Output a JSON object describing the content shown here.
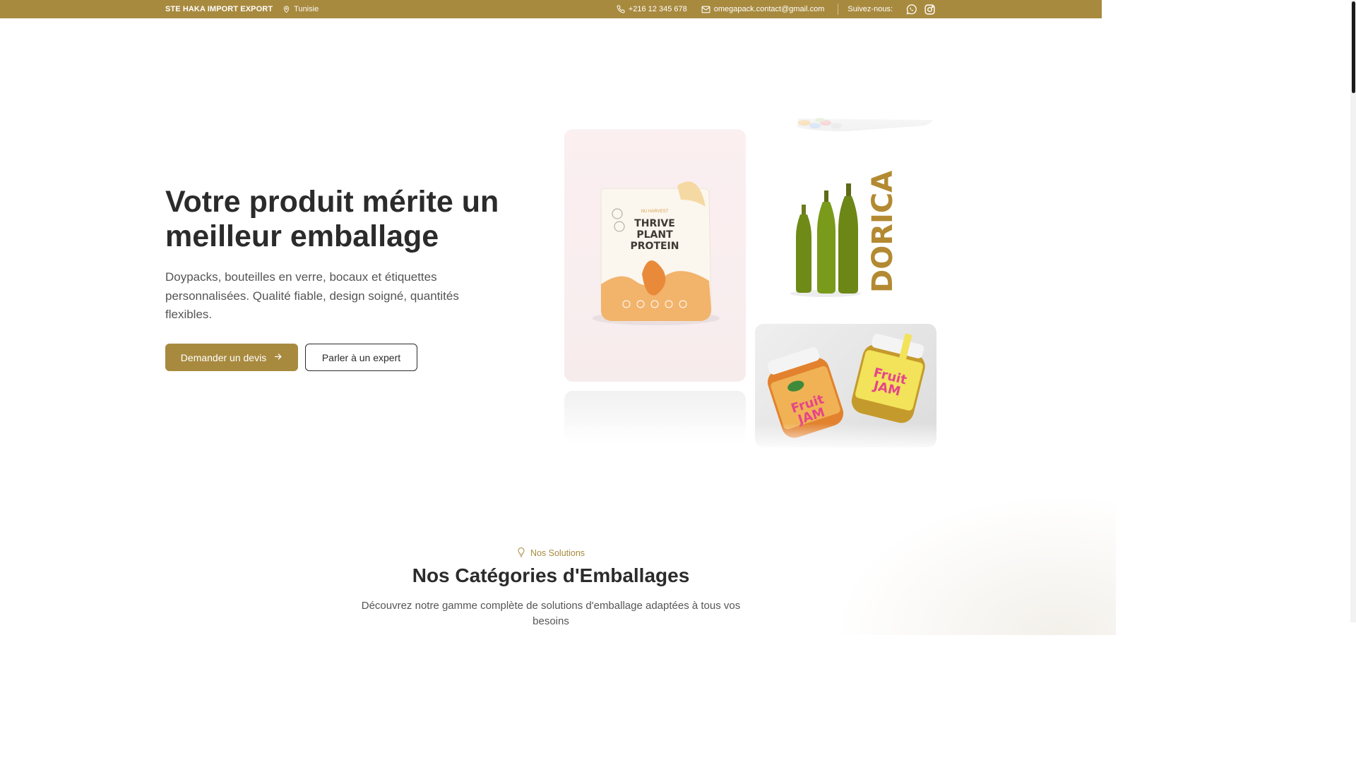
{
  "topbar": {
    "company": "STE HAKA IMPORT EXPORT",
    "location": "Tunisie",
    "phone": "+216 12 345 678",
    "email": "omegapack.contact@gmail.com",
    "follow_label": "Suivez-nous:",
    "social": [
      "whatsapp-icon",
      "instagram-icon"
    ],
    "background_color": "#a88a3f"
  },
  "hero": {
    "title": "Votre produit mérite un meilleur emballage",
    "subtitle": "Doypacks, bouteilles en verre, bocaux et étiquettes personnalisées. Qualité fiable, design soigné, quantités flexibles.",
    "primary_button": "Demander un devis",
    "secondary_button": "Parler à un expert"
  },
  "products": {
    "protein": {
      "brand": "NU HARVEST",
      "line1": "THRIVE",
      "line2": "PLANT",
      "line3": "PROTEIN"
    },
    "oil": {
      "brand": "DORICA"
    },
    "jam": {
      "label1": "Fruit",
      "label2": "JAM"
    }
  },
  "solutions": {
    "eyebrow": "Nos Solutions",
    "title": "Nos Catégories d'Emballages",
    "subtitle": "Découvrez notre gamme complète de solutions d'emballage adaptées à tous vos besoins"
  },
  "colors": {
    "accent": "#a88a3f",
    "text": "#2b2b2b",
    "muted": "#555555"
  }
}
